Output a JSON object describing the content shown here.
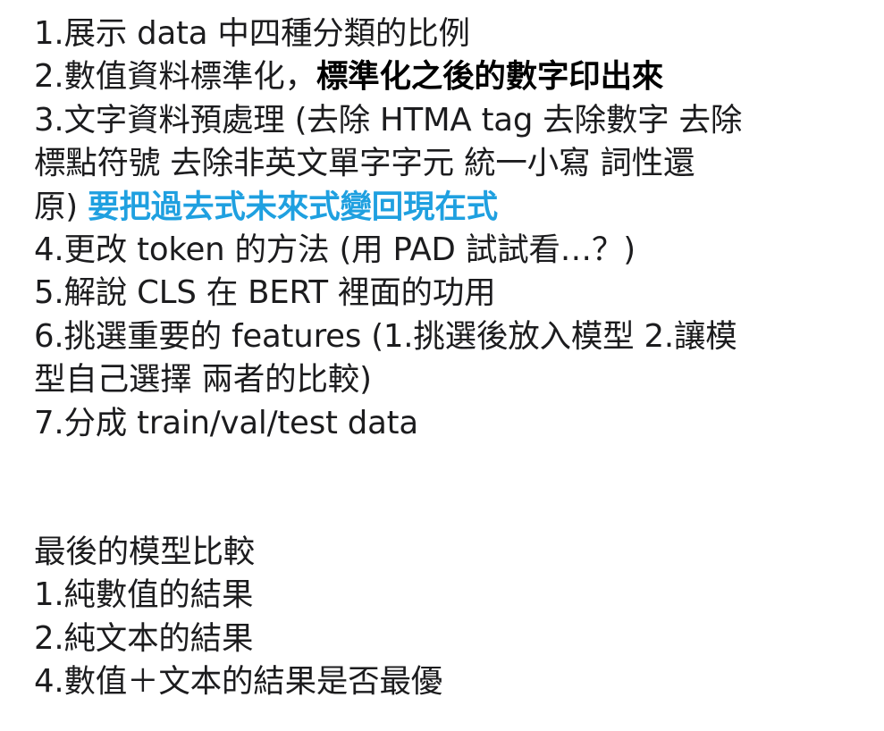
{
  "colors": {
    "text": "#1c1c1e",
    "bold_text": "#000000",
    "accent_blue": "#1fa0e0"
  },
  "todo": {
    "l1": "1.展示 data 中四種分類的比例",
    "l2a": "2.數值資料標準化，",
    "l2b": "標準化之後的數字印出來",
    "l3": "3.文字資料預處理 (去除 HTMA tag 去除數字 去除",
    "l4": "標點符號 去除非英文單字字元 統一小寫 詞性還",
    "l5a": "原) ",
    "l5b": "要把過去式未來式變回現在式",
    "l6": "4.更改 token 的方法 (用 PAD 試試看…？)",
    "l7": "5.解說 CLS 在 BERT 裡面的功用",
    "l8": "6.挑選重要的 features (1.挑選後放入模型 2.讓模",
    "l9": "型自己選擇 兩者的比較)",
    "l10": "7.分成 train/val/test data"
  },
  "compare": {
    "title": "最後的模型比較",
    "l1": "1.純數值的結果",
    "l2": "2.純文本的結果",
    "l3": "4.數值＋文本的結果是否最優"
  }
}
